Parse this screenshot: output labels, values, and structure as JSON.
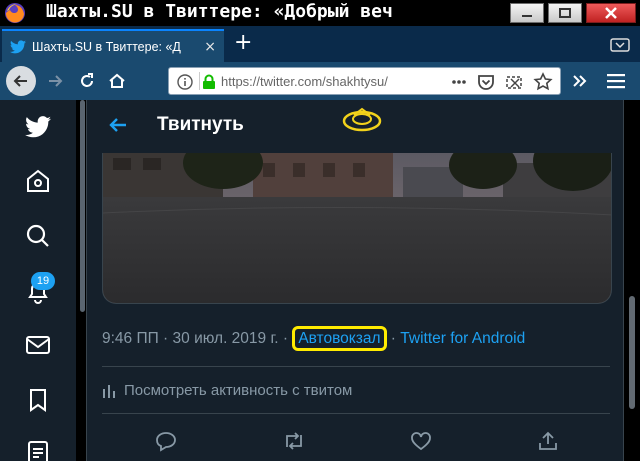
{
  "window": {
    "title": "Шахты.SU в Твиттере: «Добрый веч"
  },
  "browser": {
    "tab": {
      "title": "Шахты.SU в Твиттере: «Д",
      "close": "×"
    },
    "new_tab": "+",
    "url": "https://twitter.com/shakhtysu/"
  },
  "twitter": {
    "header_title": "Твитнуть",
    "notification_count": "19",
    "tweet": {
      "meta_prefix": "9:46 ПП · 30 июл. 2019 г. · ",
      "location": "Автовокзал",
      "meta_sep": " · ",
      "source": "Twitter for Android",
      "activity_label": "Посмотреть активность с твитом"
    }
  },
  "colors": {
    "twitter_bg": "#15202b",
    "twitter_blue": "#1da1f2",
    "highlight": "#ffeb00",
    "tab_bar": "#0a2a4a",
    "toolbar": "#1a4a6f"
  },
  "icons": {
    "sidebar": [
      "twitter-bird-icon",
      "home-icon",
      "search-icon",
      "bell-icon",
      "mail-icon",
      "bookmark-icon",
      "list-icon"
    ],
    "actions": [
      "reply-icon",
      "retweet-icon",
      "like-icon",
      "share-icon"
    ]
  }
}
